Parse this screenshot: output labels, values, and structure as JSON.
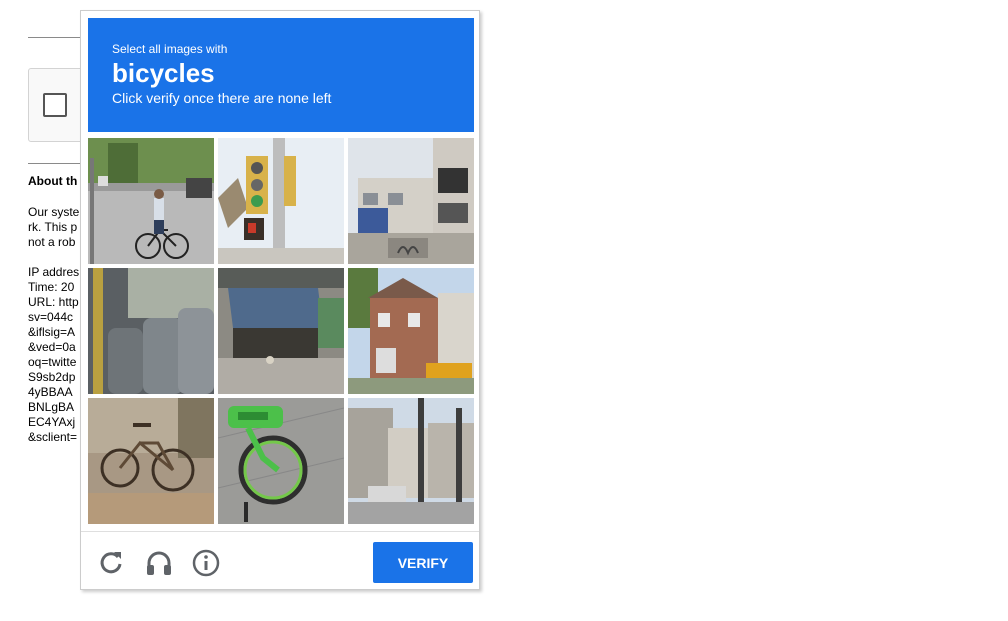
{
  "background": {
    "heading": "About th",
    "lines": [
      "Our syste",
      "rk. This p",
      "not a rob",
      "",
      "IP addres",
      "Time: 20",
      "URL: http",
      "sv=044c",
      "&iflsig=A",
      "&ved=0a",
      "oq=twitte",
      "S9sb2dp",
      "4yBBAA",
      "BNLgBA",
      "EC4YAxj",
      "&sclient="
    ]
  },
  "challenge": {
    "instruction": "Select all images with",
    "target": "bicycles",
    "subtext": "Click verify once there are none left",
    "tiles": [
      {
        "name": "tile-cyclist-street"
      },
      {
        "name": "tile-traffic-light"
      },
      {
        "name": "tile-apartment-bike-rack"
      },
      {
        "name": "tile-bus-seats"
      },
      {
        "name": "tile-storefront-awning"
      },
      {
        "name": "tile-houses-yellow-truck"
      },
      {
        "name": "tile-parked-bicycle"
      },
      {
        "name": "tile-green-bike-share"
      },
      {
        "name": "tile-buildings-street"
      }
    ],
    "verify_label": "VERIFY"
  },
  "colors": {
    "accent": "#1a73e8",
    "icon": "#5f6368"
  },
  "icons": [
    "reload-icon",
    "audio-headphones-icon",
    "info-icon"
  ]
}
